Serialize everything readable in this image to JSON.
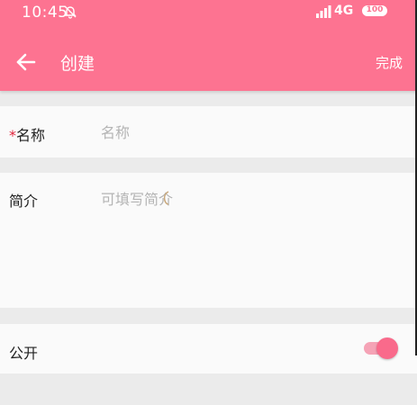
{
  "colors": {
    "header": "#fd7391",
    "accent": "#f96a8b",
    "required": "#e0243c",
    "background": "#ebebeb",
    "row": "#fafafa"
  },
  "status_bar": {
    "time": "10:45",
    "network": "4G",
    "battery": "100",
    "icons": [
      "bell-off-icon",
      "signal-icon",
      "battery-icon"
    ]
  },
  "toolbar": {
    "back_icon": "arrow-left-icon",
    "title": "创建",
    "done_label": "完成"
  },
  "form": {
    "name": {
      "required_mark": "*",
      "label": "名称",
      "placeholder": "名称",
      "value": ""
    },
    "intro": {
      "label": "简介",
      "placeholder": "可填写简介",
      "value": ""
    },
    "public": {
      "label": "公开",
      "enabled": true
    }
  }
}
